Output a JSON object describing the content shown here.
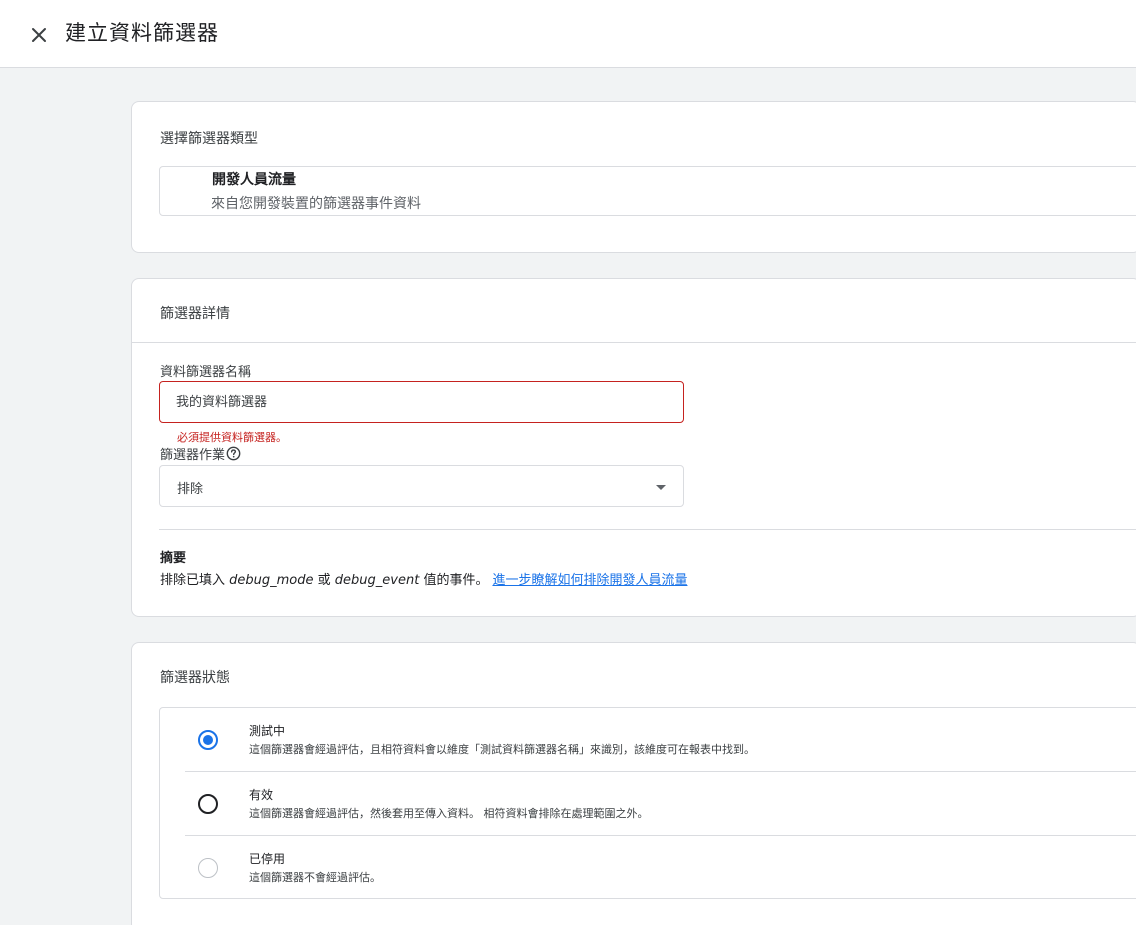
{
  "header": {
    "title": "建立資料篩選器",
    "close_icon": "close-icon"
  },
  "filter_type": {
    "heading": "選擇篩選器類型",
    "option_title": "開發人員流量",
    "option_desc": "來自您開發裝置的篩選器事件資料"
  },
  "filter_details": {
    "heading": "篩選器詳情",
    "name_label": "資料篩選器名稱",
    "name_placeholder": "我的資料篩選器",
    "name_value": "",
    "name_error": "必須提供資料篩選器。",
    "operation_label": "篩選器作業",
    "operation_help_icon": "help-circle-icon",
    "operation_value": "排除",
    "summary_title": "摘要",
    "summary_prefix": "排除已填入 ",
    "summary_param1": "debug_mode",
    "summary_or": " 或 ",
    "summary_param2": "debug_event",
    "summary_suffix": " 值的事件。",
    "summary_link": "進一步瞭解如何排除開發人員流量"
  },
  "filter_state": {
    "heading": "篩選器狀態",
    "selected": "testing",
    "options": [
      {
        "id": "testing",
        "title": "測試中",
        "desc": "這個篩選器會經過評估，且相符資料會以維度「測試資料篩選器名稱」來識別，該維度可在報表中找到。"
      },
      {
        "id": "active",
        "title": "有效",
        "desc": "這個篩選器會經過評估，然後套用至傳入資料。 相符資料會排除在處理範圍之外。"
      },
      {
        "id": "inactive",
        "title": "已停用",
        "desc": "這個篩選器不會經過評估。"
      }
    ]
  },
  "colors": {
    "accent": "#1a73e8",
    "error": "#c5221f",
    "border": "#dadce0",
    "background": "#f1f3f4"
  }
}
